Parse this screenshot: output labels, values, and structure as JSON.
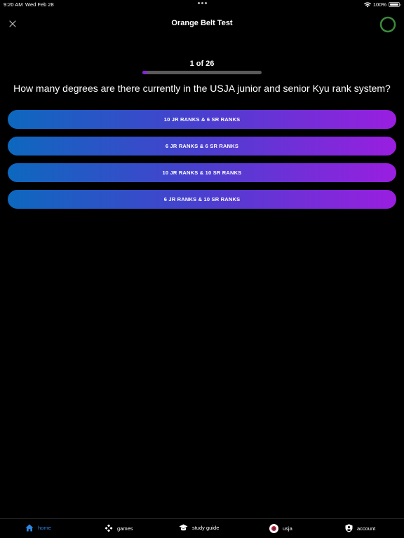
{
  "status_bar": {
    "time": "9:20 AM",
    "date": "Wed Feb 28",
    "battery": "100%"
  },
  "header": {
    "title": "Orange Belt Test",
    "close_icon": "close-icon",
    "progress_ring_color": "#3b8a3b"
  },
  "quiz": {
    "counter": "1 of 26",
    "progress_fraction": 0.04,
    "question": "How many degrees are there currently in the USJA junior and senior Kyu rank system?",
    "answers": [
      "10 JR RANKS & 6 SR RANKS",
      "6 JR RANKS & 6 SR RANKS",
      "10 JR RANKS & 10 SR RANKS",
      "6 JR RANKS & 10 SR RANKS"
    ]
  },
  "tab_bar": {
    "items": [
      {
        "label": "home",
        "icon": "home-icon",
        "active": true
      },
      {
        "label": "games",
        "icon": "gamepad-icon",
        "active": false
      },
      {
        "label": "study guide",
        "icon": "graduation-cap-icon",
        "active": false
      },
      {
        "label": "usja",
        "icon": "usja-logo",
        "active": false
      },
      {
        "label": "account",
        "icon": "account-shield-icon",
        "active": false
      }
    ]
  },
  "colors": {
    "accent_active": "#2d86e0",
    "gradient_start": "#0d68be",
    "gradient_end": "#9a1ee0",
    "progress_fill": "#8a22dd"
  }
}
